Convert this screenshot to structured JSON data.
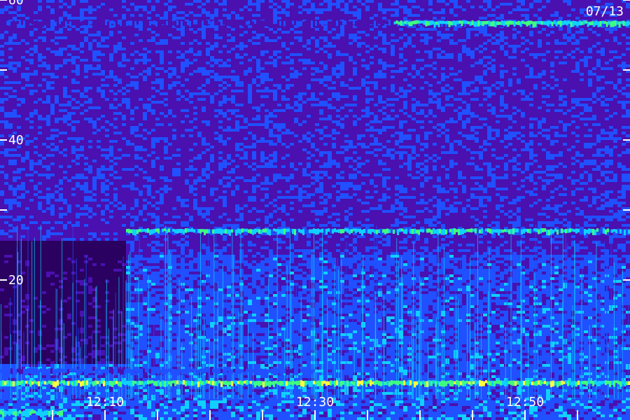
{
  "chart_data": {
    "type": "heatmap",
    "date_label": "07/13",
    "x_axis": {
      "unit": "time",
      "range": [
        "12:00",
        "12:59"
      ],
      "tick_labels": [
        "12:10",
        "12:30",
        "12:50"
      ],
      "major_ticks_minutes": [
        10,
        30,
        50
      ],
      "minor_tick_interval_minutes": 5
    },
    "y_axis": {
      "range": [
        0,
        60
      ],
      "tick_labels": [
        "60",
        "40",
        "20"
      ],
      "tick_values": [
        60,
        40,
        20
      ],
      "unlabeled_tick_values": [
        50,
        30
      ]
    },
    "colormap": [
      "#000000",
      "#2a0060",
      "#4a10b0",
      "#2050ff",
      "#10d0ff",
      "#40ff80",
      "#ffff40"
    ],
    "background_level": 0.28,
    "bands": [
      {
        "freq": 56.7,
        "start_min": 0,
        "end_min": 60,
        "intensity": 0.45
      },
      {
        "freq": 56.7,
        "start_min": 37.5,
        "end_min": 60,
        "intensity": 0.85
      },
      {
        "freq": 27.0,
        "start_min": 12,
        "end_min": 60,
        "intensity": 0.78
      },
      {
        "freq": 5.3,
        "start_min": 0,
        "end_min": 60,
        "intensity": 0.95
      },
      {
        "freq": 7.0,
        "start_min": 0,
        "end_min": 30,
        "intensity": 0.55
      },
      {
        "freq": 1.0,
        "start_min": 0,
        "end_min": 6,
        "intensity": 0.85
      }
    ]
  }
}
